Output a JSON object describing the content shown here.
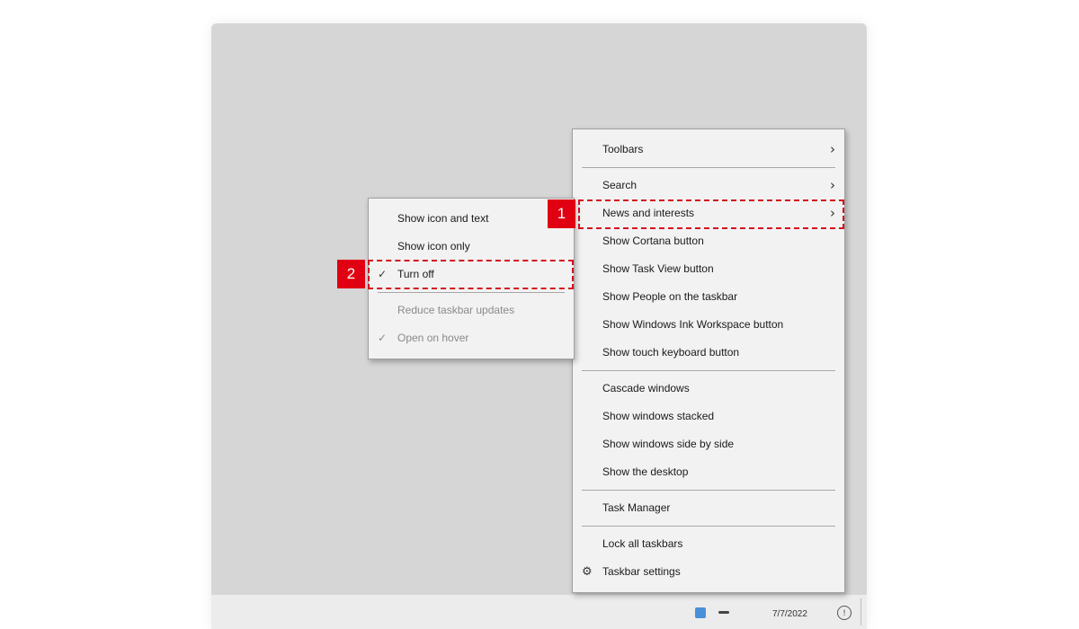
{
  "main_menu": {
    "items": [
      {
        "label": "Toolbars"
      },
      {
        "label": "Search"
      },
      {
        "label": "News and interests"
      },
      {
        "label": "Show Cortana button"
      },
      {
        "label": "Show Task View button"
      },
      {
        "label": "Show People on the taskbar"
      },
      {
        "label": "Show Windows Ink Workspace button"
      },
      {
        "label": "Show touch keyboard button"
      },
      {
        "label": "Cascade windows"
      },
      {
        "label": "Show windows stacked"
      },
      {
        "label": "Show windows side by side"
      },
      {
        "label": "Show the desktop"
      },
      {
        "label": "Task Manager"
      },
      {
        "label": "Lock all taskbars"
      },
      {
        "label": "Taskbar settings"
      }
    ]
  },
  "sub_menu": {
    "items": [
      {
        "label": "Show icon and text"
      },
      {
        "label": "Show icon only"
      },
      {
        "label": "Turn off",
        "checked": true
      },
      {
        "label": "Reduce taskbar updates",
        "disabled": true
      },
      {
        "label": "Open on hover",
        "checked": true,
        "disabled": true
      }
    ]
  },
  "annotations": {
    "step1": "1",
    "step2": "2"
  },
  "taskbar": {
    "time": "7/7/2022"
  },
  "icons": {
    "chevron": "chevron-right-icon",
    "check": "checkmark-icon",
    "gear": "gear-icon"
  },
  "colors": {
    "accent": "#e00012",
    "menu_bg": "#f2f2f2",
    "desktop_bg": "#d6d6d6"
  }
}
